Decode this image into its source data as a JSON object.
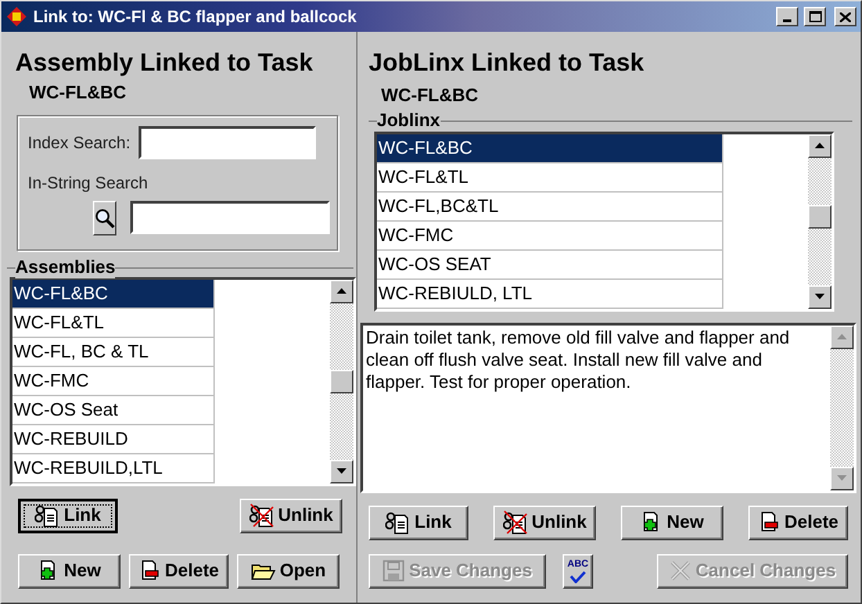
{
  "window": {
    "title": "Link to: WC-Fl & BC flapper and ballcock"
  },
  "assembly_panel": {
    "heading": "Assembly Linked to Task",
    "subtitle": "WC-FL&BC",
    "index_search": {
      "label": "Index Search:"
    },
    "instring_search": {
      "label": "In-String Search"
    },
    "assemblies": {
      "label": "Assemblies",
      "items": [
        {
          "text": "WC-FL&BC",
          "selected": true
        },
        {
          "text": "WC-FL&TL",
          "selected": false
        },
        {
          "text": "WC-FL, BC & TL",
          "selected": false
        },
        {
          "text": "WC-FMC",
          "selected": false
        },
        {
          "text": "WC-OS Seat",
          "selected": false
        },
        {
          "text": "WC-REBUILD",
          "selected": false
        },
        {
          "text": "WC-REBUILD,LTL",
          "selected": false
        }
      ]
    },
    "buttons": [
      {
        "kind": "link",
        "label": "Link",
        "focused": true,
        "disabled": false
      },
      {
        "kind": "unlink",
        "label": "Unlink",
        "focused": false,
        "disabled": false
      },
      {
        "kind": "new",
        "label": "New",
        "focused": false,
        "disabled": false
      },
      {
        "kind": "delete",
        "label": "Delete",
        "focused": false,
        "disabled": false
      },
      {
        "kind": "open",
        "label": "Open",
        "focused": false,
        "disabled": false
      }
    ]
  },
  "joblinx_panel": {
    "heading": "JobLinx Linked to Task",
    "subtitle": "WC-FL&BC",
    "joblinx": {
      "label": "Joblinx",
      "items": [
        {
          "text": "WC-FL&BC",
          "selected": true
        },
        {
          "text": "WC-FL&TL",
          "selected": false
        },
        {
          "text": "WC-FL,BC&TL",
          "selected": false
        },
        {
          "text": "WC-FMC",
          "selected": false
        },
        {
          "text": "WC-OS SEAT",
          "selected": false
        },
        {
          "text": "WC-REBIULD, LTL",
          "selected": false
        }
      ]
    },
    "description": "Drain toilet tank, remove old fill valve and flapper and clean off flush valve seat. Install new fill valve and flapper. Test for proper operation.",
    "buttons": [
      {
        "kind": "link",
        "label": "Link",
        "focused": false,
        "disabled": false
      },
      {
        "kind": "unlink",
        "label": "Unlink",
        "focused": false,
        "disabled": false
      },
      {
        "kind": "new",
        "label": "New",
        "focused": false,
        "disabled": false
      },
      {
        "kind": "delete",
        "label": "Delete",
        "focused": false,
        "disabled": false
      },
      {
        "kind": "save",
        "label": "Save Changes",
        "focused": false,
        "disabled": true
      },
      {
        "kind": "spell",
        "label": "ABC",
        "focused": false,
        "disabled": false
      },
      {
        "kind": "cancel",
        "label": "Cancel Changes",
        "focused": false,
        "disabled": true
      }
    ]
  }
}
